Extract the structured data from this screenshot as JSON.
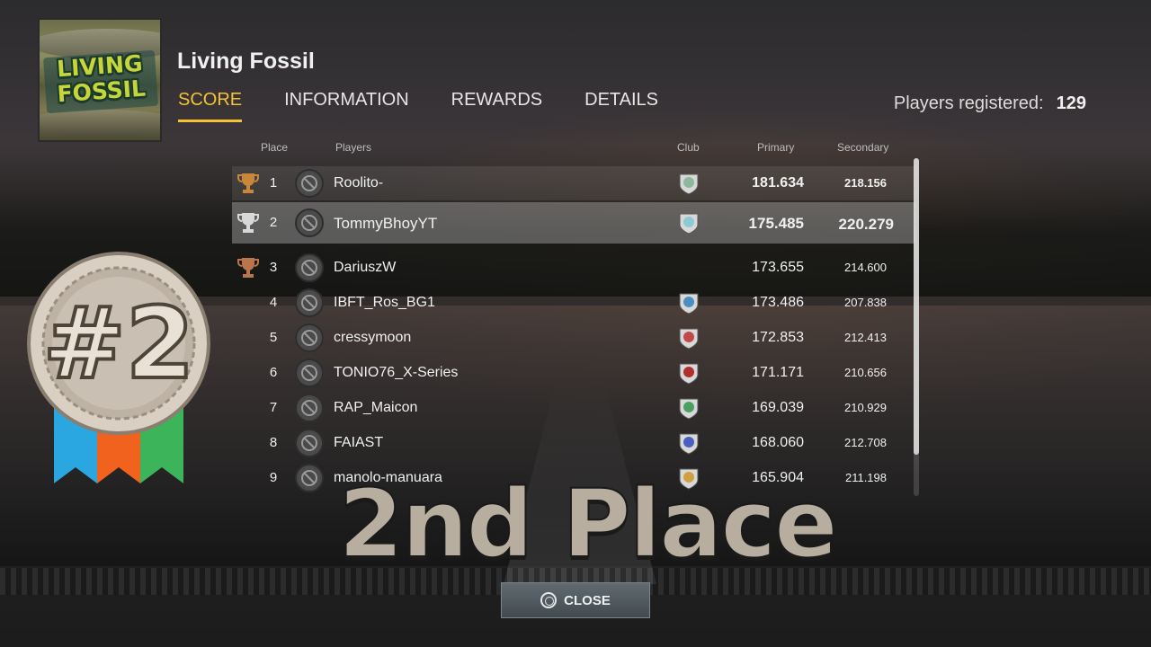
{
  "event": {
    "title": "Living Fossil",
    "logo_text": "LIVING FOSSIL"
  },
  "tabs": [
    {
      "label": "SCORE",
      "active": true
    },
    {
      "label": "INFORMATION",
      "active": false
    },
    {
      "label": "REWARDS",
      "active": false
    },
    {
      "label": "DETAILS",
      "active": false
    }
  ],
  "registered": {
    "label": "Players registered:",
    "count": "129"
  },
  "columns": {
    "place": "Place",
    "players": "Players",
    "club": "Club",
    "primary": "Primary",
    "secondary": "Secondary"
  },
  "leaderboard": [
    {
      "place": "1",
      "player": "Roolito-",
      "primary": "181.634",
      "secondary": "218.156",
      "trophy": "gold",
      "club_color": "#8fb7a0"
    },
    {
      "place": "2",
      "player": "TommyBhoyYT",
      "primary": "175.485",
      "secondary": "220.279",
      "trophy": "silver",
      "club_color": "#8ec9d6"
    },
    {
      "place": "3",
      "player": "DariuszW",
      "primary": "173.655",
      "secondary": "214.600",
      "trophy": "bronze",
      "club_color": ""
    },
    {
      "place": "4",
      "player": "IBFT_Ros_BG1",
      "primary": "173.486",
      "secondary": "207.838",
      "trophy": "",
      "club_color": "#4a8fc0"
    },
    {
      "place": "5",
      "player": "cressymoon",
      "primary": "172.853",
      "secondary": "212.413",
      "trophy": "",
      "club_color": "#c04a4a"
    },
    {
      "place": "6",
      "player": "TONIO76_X-Series",
      "primary": "171.171",
      "secondary": "210.656",
      "trophy": "",
      "club_color": "#b03030"
    },
    {
      "place": "7",
      "player": "RAP_Maicon",
      "primary": "169.039",
      "secondary": "210.929",
      "trophy": "",
      "club_color": "#4aa060"
    },
    {
      "place": "8",
      "player": "FAIAST",
      "primary": "168.060",
      "secondary": "212.708",
      "trophy": "",
      "club_color": "#4a60c0"
    },
    {
      "place": "9",
      "player": "manolo-manuara",
      "primary": "165.904",
      "secondary": "211.198",
      "trophy": "",
      "club_color": "#d0a040"
    }
  ],
  "medal": {
    "text": "#2",
    "ribbon_colors": [
      "#2aa7e0",
      "#f0621e",
      "#3cb55a"
    ]
  },
  "overlay_title": "2nd Place",
  "close_button": "CLOSE"
}
